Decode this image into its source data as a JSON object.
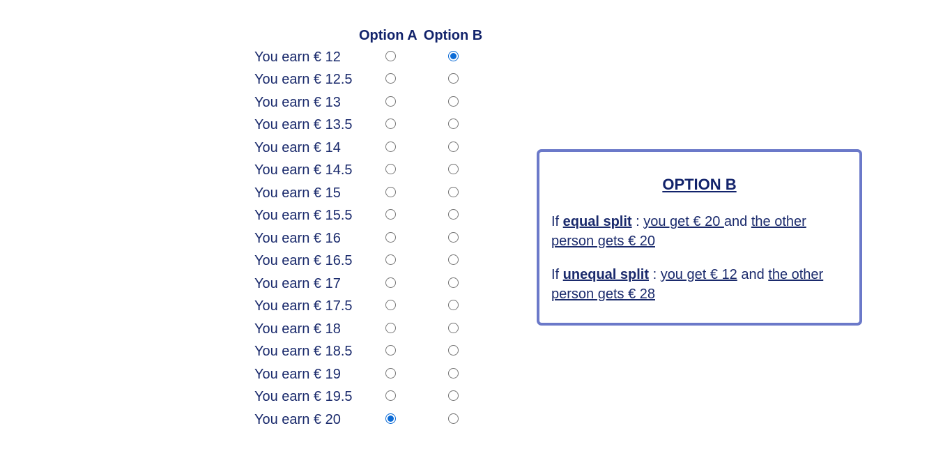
{
  "table": {
    "header_a": "Option A",
    "header_b": "Option B",
    "rows": [
      {
        "label": "You earn € 12",
        "a": false,
        "b": true
      },
      {
        "label": "You earn € 12.5",
        "a": false,
        "b": false
      },
      {
        "label": "You earn € 13",
        "a": false,
        "b": false
      },
      {
        "label": "You earn € 13.5",
        "a": false,
        "b": false
      },
      {
        "label": "You earn € 14",
        "a": false,
        "b": false
      },
      {
        "label": "You earn € 14.5",
        "a": false,
        "b": false
      },
      {
        "label": "You earn € 15",
        "a": false,
        "b": false
      },
      {
        "label": "You earn € 15.5",
        "a": false,
        "b": false
      },
      {
        "label": "You earn € 16",
        "a": false,
        "b": false
      },
      {
        "label": "You earn € 16.5",
        "a": false,
        "b": false
      },
      {
        "label": "You earn € 17",
        "a": false,
        "b": false
      },
      {
        "label": "You earn € 17.5",
        "a": false,
        "b": false
      },
      {
        "label": "You earn € 18",
        "a": false,
        "b": false
      },
      {
        "label": "You earn € 18.5",
        "a": false,
        "b": false
      },
      {
        "label": "You earn € 19",
        "a": false,
        "b": false
      },
      {
        "label": "You earn € 19.5",
        "a": false,
        "b": false
      },
      {
        "label": "You earn € 20",
        "a": true,
        "b": false
      }
    ]
  },
  "info_box": {
    "title": "OPTION B",
    "line1": {
      "prefix": "If ",
      "split_label": "equal split",
      "sep": " : ",
      "you_get": "you get € 20 ",
      "and": "and ",
      "other_gets": "the other person gets € 20"
    },
    "line2": {
      "prefix": "If ",
      "split_label": "unequal split",
      "sep": " : ",
      "you_get": "you get € 12",
      "and": " and ",
      "other_gets": "the other person gets € 28"
    },
    "border_color": "#6b79c9",
    "text_color": "#1a2a6c"
  }
}
